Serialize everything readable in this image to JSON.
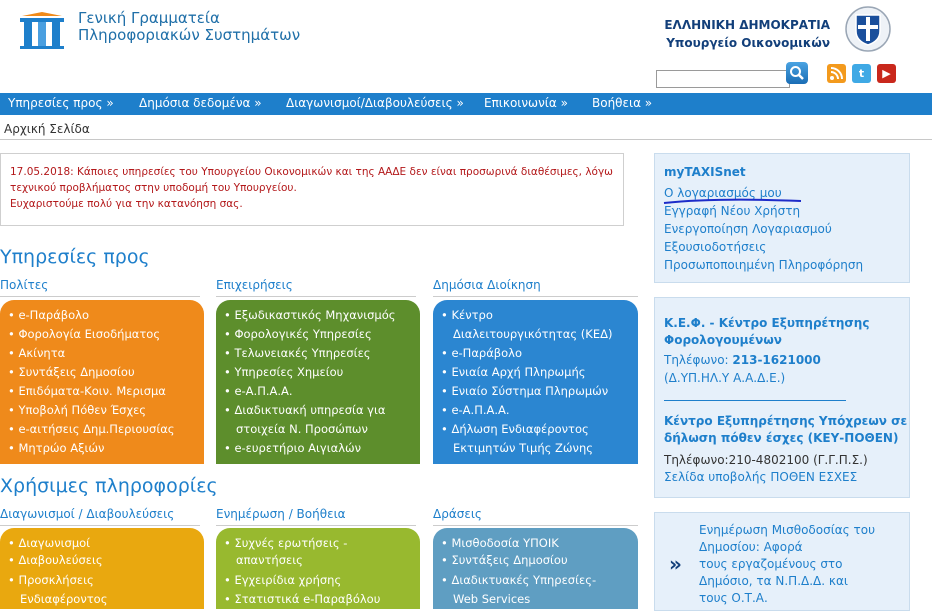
{
  "header": {
    "agency_line1": "Γενική Γραμματεία",
    "agency_line2": "Πληροφοριακών Συστημάτων",
    "republic": "ΕΛΛΗΝΙΚΗ ΔΗΜΟΚΡΑΤΙΑ",
    "ministry": "Υπουργείο Οικονομικών",
    "search_value": "",
    "social_icons": [
      "rss-icon",
      "twitter-icon",
      "youtube-icon"
    ]
  },
  "nav": [
    "Υπηρεσίες προς »",
    "Δημόσια δεδομένα »",
    "Διαγωνισμοί/Διαβουλεύσεις »",
    "Επικοινωνία »",
    "Βοήθεια »"
  ],
  "breadcrumb": "Αρχική Σελίδα",
  "notice": {
    "line1": "17.05.2018: Κάποιες υπηρεσίες του Υπουργείου Οικονομικών και της ΑΑΔΕ δεν είναι προσωρινά διαθέσιμες, λόγω",
    "line2": "τεχνικού προβλήματος στην υποδομή του Υπουργείου.",
    "line3": "Ευχαριστούμε πολύ για την κατανόηση σας."
  },
  "services": {
    "title": "Υπηρεσίες προς",
    "columns": [
      {
        "title": "Πολίτες",
        "items": [
          "e-Παράβολο",
          "Φορολογία Εισοδήματος",
          "Ακίνητα",
          "Συντάξεις Δημοσίου",
          "Επιδόματα-Κοιν. Μερισμα",
          "Υποβολή Πόθεν Έσχες",
          "e-αιτήσεις Δημ.Περιουσίας",
          "Μητρώο Αξιών"
        ]
      },
      {
        "title": "Επιχειρήσεις",
        "items": [
          "Εξωδικαστικός Μηχανισμός",
          "Φορολογικές Υπηρεσίες",
          "Τελωνειακές Υπηρεσίες",
          "Υπηρεσίες Χημείου",
          "e-Α.Π.Α.Α.",
          "Διαδικτυακή υπηρεσία για",
          "στοιχεία Ν. Προσώπων",
          "e-ευρετήριο Αιγιαλών"
        ]
      },
      {
        "title": "Δημόσια Διοίκηση",
        "items": [
          "Κέντρο",
          "Διαλειτουργικότητας (ΚΕΔ)",
          "e-Παράβολο",
          "Ενιαία Αρχή Πληρωμής",
          "Ενιαίο Σύστημα Πληρωμών",
          "e-Α.Π.Α.Α.",
          "Δήλωση Ενδιαφέροντος",
          "Εκτιμητών Τιμής Ζώνης"
        ]
      }
    ]
  },
  "useful": {
    "title": "Χρήσιμες πληροφορίες",
    "columns": [
      {
        "title": "Διαγωνισμοί / Διαβουλεύσεις",
        "items": [
          "Διαγωνισμοί",
          "Διαβουλεύσεις",
          "Προσκλήσεις",
          "Ενδιαφέροντος"
        ]
      },
      {
        "title": "Ενημέρωση / Βοήθεια",
        "items": [
          "Συχνές ερωτήσεις -",
          "απαντήσεις",
          "Εγχειρίδια χρήσης",
          "Στατιστικά e-Παραβόλου"
        ]
      },
      {
        "title": "Δράσεις",
        "items": [
          "Μισθοδοσία ΥΠΟΙΚ",
          "Συντάξεις Δημοσίου",
          "Διαδικτυακές Υπηρεσίες-",
          "Web Services"
        ]
      }
    ]
  },
  "sidebar": {
    "taxisnet": {
      "title": "myTAXISnet",
      "links": [
        "Ο λογαριασμός μου",
        "Εγγραφή Νέου Χρήστη",
        "Ενεργοποίηση Λογαριασμού",
        "Εξουσιοδοτήσεις",
        "Προσωποποιημένη Πληροφόρηση"
      ]
    },
    "kef": {
      "title1": "Κ.Ε.Φ. - Κέντρο Εξυπηρέτησης",
      "title2": "Φορολογουμένων",
      "phone_label": "Τηλέφωνο:",
      "phone": "213-1621000",
      "phone_note": "(Δ.ΥΠ.ΗΛ.Υ Α.Α.Δ.Ε.)",
      "center_title1": "Κέντρο Εξυπηρέτησης Υπόχρεων σε",
      "center_title2": "δήλωση πόθεν έσχες (ΚΕΥ-ΠΟΘΕΝ)",
      "center_phone": "Τηλέφωνο:210-4802100 (Γ.Γ.Π.Σ.)",
      "center_link": "Σελίδα υποβολής ΠΟΘΕΝ ΕΣΧΕΣ"
    },
    "news": {
      "arrow": "»",
      "lines": [
        "Ενημέρωση Μισθοδοσίας του",
        "Δημοσίου: Αφορά",
        "τους εργαζομένους στο",
        "Δημόσιο, τα Ν.Π.Δ.Δ. και",
        "τους Ο.Τ.Α."
      ]
    }
  },
  "colors": {
    "nav": "#1e7fcb",
    "notice_text": "#b3181a",
    "orange": "#ef8a1b",
    "green": "#5d8e2c",
    "blue": "#2b86d1",
    "yellow": "#e9a80f",
    "light_green": "#98b92f",
    "teal": "#5f9ec2"
  }
}
